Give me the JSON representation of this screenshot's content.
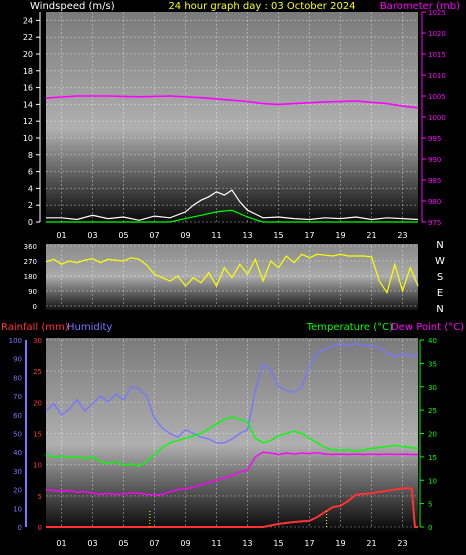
{
  "header": {
    "left_label": "Windspeed (m/s)",
    "center_title": "24 hour graph day : 03 October 2024",
    "right_label": "Barometer (mb)"
  },
  "colors": {
    "windspeed_label": "#ffffff",
    "title": "#ffff00",
    "barometer": "#ff00ff",
    "wind_avg": "#ffffff",
    "wind_gust": "#00ff00",
    "direction": "#ffff00",
    "rainfall": "#ff3333",
    "humidity": "#7777ff",
    "temperature": "#00ff00",
    "dewpoint": "#ff00ff",
    "rain_axis": "#ff3333"
  },
  "hour_labels": [
    "01",
    "03",
    "05",
    "07",
    "09",
    "11",
    "13",
    "15",
    "17",
    "19",
    "21",
    "23"
  ],
  "compass_labels": [
    "N",
    "W",
    "S",
    "E",
    "N"
  ],
  "legend_bottom": {
    "rainfall": "Rainfall (mm)",
    "humidity": "Humidity",
    "temperature": "Temperature (°C)",
    "dewpoint": "Dew Point (°C)"
  },
  "chart_data": [
    {
      "type": "line",
      "name": "wind-barometer",
      "x_unit": "hour",
      "xlim": [
        0,
        24
      ],
      "y_left": {
        "ticks": [
          0,
          2,
          4,
          6,
          8,
          10,
          12,
          14,
          16,
          18,
          20,
          22,
          24
        ],
        "ylim": [
          0,
          25
        ]
      },
      "y_right": {
        "ticks": [
          975,
          980,
          985,
          990,
          995,
          1000,
          1005,
          1010,
          1015,
          1020,
          1025
        ],
        "ylim": [
          975,
          1025
        ]
      },
      "series": [
        {
          "name": "Barometer (mb)",
          "axis": "right",
          "x": [
            0,
            2,
            4,
            6,
            8,
            10,
            12,
            13,
            14,
            15,
            16,
            18,
            20,
            21,
            22,
            23,
            24
          ],
          "y": [
            1004.5,
            1005,
            1005,
            1004.8,
            1005,
            1004.6,
            1004,
            1003.7,
            1003.2,
            1003,
            1003.2,
            1003.6,
            1003.8,
            1003.5,
            1003.2,
            1002.6,
            1002.2
          ]
        },
        {
          "axis": "left",
          "x": [
            0,
            1,
            2,
            3,
            4,
            5,
            6,
            7,
            8,
            9,
            9.5,
            10,
            10.5,
            11,
            11.5,
            12,
            12.5,
            13,
            14,
            15,
            16,
            17,
            18,
            19,
            20,
            21,
            22,
            23,
            24
          ],
          "y": [
            0.5,
            0.5,
            0.3,
            0.8,
            0.4,
            0.6,
            0.2,
            0.7,
            0.5,
            1.2,
            2,
            2.6,
            3,
            3.6,
            3.2,
            3.8,
            2.4,
            1.4,
            0.5,
            0.6,
            0.4,
            0.3,
            0.5,
            0.4,
            0.6,
            0.3,
            0.5,
            0.4,
            0.3
          ]
        },
        {
          "axis": "left",
          "x": [
            0,
            2,
            4,
            6,
            8,
            9,
            10,
            11,
            12,
            13,
            14,
            16,
            18,
            20,
            22,
            24
          ],
          "y": [
            0,
            0,
            0,
            0,
            0,
            0.4,
            0.8,
            1.2,
            1.4,
            0.6,
            0,
            0,
            0,
            0,
            0,
            0
          ]
        }
      ]
    },
    {
      "type": "scatter",
      "name": "wind-direction",
      "x_unit": "hour",
      "xlim": [
        0,
        24
      ],
      "y_ticks": [
        0,
        90,
        180,
        270,
        360
      ],
      "ylim": [
        0,
        360
      ],
      "series": [
        {
          "x": [
            0,
            0.5,
            1,
            1.5,
            2,
            2.5,
            3,
            3.5,
            4,
            4.5,
            5,
            5.5,
            6,
            6.5,
            7,
            7.5,
            8,
            8.5,
            9,
            9.5,
            10,
            10.5,
            11,
            11.5,
            12,
            12.5,
            13,
            13.5,
            14,
            14.5,
            15,
            15.5,
            16,
            16.5,
            17,
            17.5,
            18,
            18.5,
            19,
            19.5,
            20,
            20.5,
            21,
            21.5,
            22,
            22.5,
            23,
            23.5,
            24
          ],
          "y": [
            265,
            280,
            250,
            270,
            260,
            275,
            285,
            260,
            280,
            275,
            270,
            290,
            280,
            245,
            190,
            170,
            150,
            180,
            120,
            170,
            140,
            200,
            120,
            230,
            170,
            250,
            190,
            280,
            150,
            270,
            230,
            300,
            260,
            310,
            290,
            310,
            305,
            300,
            310,
            300,
            300,
            300,
            295,
            150,
            80,
            250,
            90,
            230,
            120
          ]
        }
      ]
    },
    {
      "type": "line",
      "name": "rain-humidity-temperature",
      "x_unit": "hour",
      "xlim": [
        0,
        24
      ],
      "y_humidity": {
        "ticks": [
          0,
          10,
          20,
          30,
          40,
          50,
          60,
          70,
          80,
          90,
          100
        ],
        "ylim": [
          0,
          100
        ]
      },
      "y_rain": {
        "ticks": [
          0,
          5,
          10,
          15,
          20,
          25,
          30
        ],
        "ylim": [
          0,
          30
        ]
      },
      "y_temp": {
        "ticks": [
          0,
          5,
          10,
          15,
          20,
          25,
          30,
          35,
          40
        ],
        "ylim": [
          0,
          40
        ]
      },
      "series": [
        {
          "name": "Humidity",
          "axis": "humidity",
          "x": [
            0,
            0.5,
            1,
            1.5,
            2,
            2.5,
            3,
            3.5,
            4,
            4.5,
            5,
            5.5,
            6,
            6.5,
            7,
            7.5,
            8,
            8.5,
            9,
            9.5,
            10,
            10.5,
            11,
            11.5,
            12,
            12.5,
            13,
            13.5,
            14,
            14.5,
            15,
            15.5,
            16,
            16.5,
            17,
            17.5,
            18,
            18.5,
            19,
            19.5,
            20,
            20.5,
            21,
            21.5,
            22,
            22.5,
            23,
            23.5,
            24
          ],
          "y": [
            62,
            66,
            60,
            63,
            68,
            62,
            66,
            70,
            67,
            71,
            68,
            75,
            74,
            70,
            58,
            53,
            50,
            48,
            52,
            50,
            48,
            47,
            45,
            45,
            47,
            50,
            52,
            73,
            87,
            84,
            75,
            73,
            72,
            75,
            86,
            93,
            95,
            97,
            98,
            97,
            98,
            97,
            97,
            96,
            93,
            91,
            93,
            91,
            93
          ]
        },
        {
          "name": "Temperature (°C)",
          "axis": "temp",
          "x": [
            0,
            0.5,
            1,
            1.5,
            2,
            2.5,
            3,
            3.5,
            4,
            4.5,
            5,
            5.5,
            6,
            6.5,
            7,
            7.5,
            8,
            8.5,
            9,
            9.5,
            10,
            10.5,
            11,
            11.5,
            12,
            12.5,
            13,
            13.5,
            14,
            14.5,
            15,
            15.5,
            16,
            16.5,
            17,
            17.5,
            18,
            18.5,
            19,
            19.5,
            20,
            20.5,
            21,
            21.5,
            22,
            22.5,
            23,
            23.5,
            24
          ],
          "y": [
            15.5,
            15,
            15.2,
            14.8,
            15,
            14.7,
            15,
            14,
            13.5,
            14,
            13.2,
            13.5,
            13,
            14,
            15.5,
            17,
            18,
            18.5,
            19,
            19.5,
            20,
            21,
            22,
            23,
            23.5,
            23,
            22.5,
            19,
            18,
            18.5,
            19.5,
            20,
            20.5,
            20,
            19,
            18,
            17,
            16.5,
            16.5,
            16.5,
            16.2,
            16.5,
            16.8,
            17,
            17.2,
            17.5,
            17.2,
            17,
            16.8
          ]
        },
        {
          "name": "Dew Point (°C)",
          "axis": "temp",
          "x": [
            0,
            0.5,
            1,
            1.5,
            2,
            2.5,
            3,
            3.5,
            4,
            4.5,
            5,
            5.5,
            6,
            6.5,
            7,
            7.5,
            8,
            8.5,
            9,
            9.5,
            10,
            10.5,
            11,
            11.5,
            12,
            12.5,
            13,
            13.5,
            14,
            14.5,
            15,
            15.5,
            16,
            16.5,
            17,
            17.5,
            18,
            18.5,
            19,
            19.5,
            20,
            20.5,
            21,
            21.5,
            22,
            22.5,
            23,
            23.5,
            24
          ],
          "y": [
            8,
            7.8,
            7.6,
            7.8,
            7.4,
            7.6,
            7.2,
            7,
            7.2,
            7,
            7.1,
            7.3,
            7.2,
            7,
            6.8,
            7,
            7.5,
            8,
            8.2,
            8.5,
            9,
            9.5,
            10,
            10.5,
            11,
            11.8,
            12.2,
            15,
            16,
            15.8,
            15.5,
            15.8,
            15.6,
            15.8,
            15.7,
            15.9,
            15.6,
            15.5,
            15.6,
            15.5,
            15.6,
            15.5,
            15.6,
            15.5,
            15.6,
            15.5,
            15.6,
            15.5,
            15.5
          ]
        },
        {
          "name": "Rainfall (mm)",
          "axis": "rain",
          "x": [
            0,
            6,
            12,
            13,
            14,
            15,
            16,
            17,
            17.5,
            18,
            18.5,
            19,
            19.5,
            20,
            21,
            22,
            23,
            23.6,
            23.8,
            24
          ],
          "y": [
            0,
            0,
            0,
            0,
            0,
            0.5,
            0.8,
            1,
            1.6,
            2.4,
            3.2,
            3.4,
            4.2,
            5.2,
            5.4,
            5.8,
            6.2,
            6.2,
            0,
            0
          ]
        }
      ],
      "rain_markers_x": [
        6.7,
        18.1
      ]
    }
  ]
}
